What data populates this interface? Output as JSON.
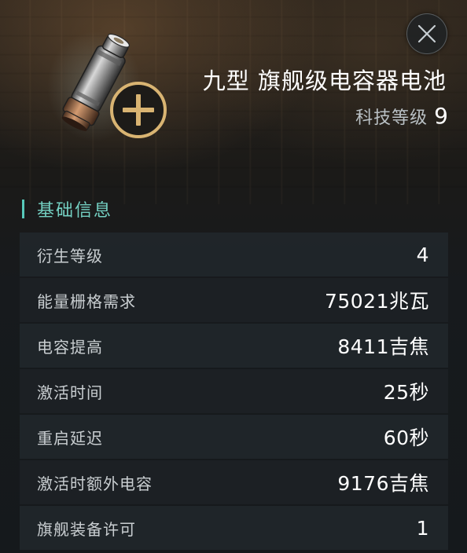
{
  "item": {
    "title": "九型 旗舰级电容器电池",
    "tech_level_label": "科技等级",
    "tech_level_value": "9",
    "icon": "capacitor-battery-icon",
    "badge_icon": "plus-icon"
  },
  "close_icon": "close-icon",
  "section": {
    "title": "基础信息"
  },
  "attributes": [
    {
      "label": "衍生等级",
      "value": "4"
    },
    {
      "label": "能量栅格需求",
      "value": "75021兆瓦"
    },
    {
      "label": "电容提高",
      "value": "8411吉焦"
    },
    {
      "label": "激活时间",
      "value": "25秒"
    },
    {
      "label": "重启延迟",
      "value": "60秒"
    },
    {
      "label": "激活时额外电容",
      "value": "9176吉焦"
    },
    {
      "label": "旗舰装备许可",
      "value": "1"
    }
  ],
  "colors": {
    "accent": "#57c9ba",
    "accent_text": "#74d0c2",
    "badge_gold": "#d9b472",
    "row_bg": "#21262a"
  }
}
